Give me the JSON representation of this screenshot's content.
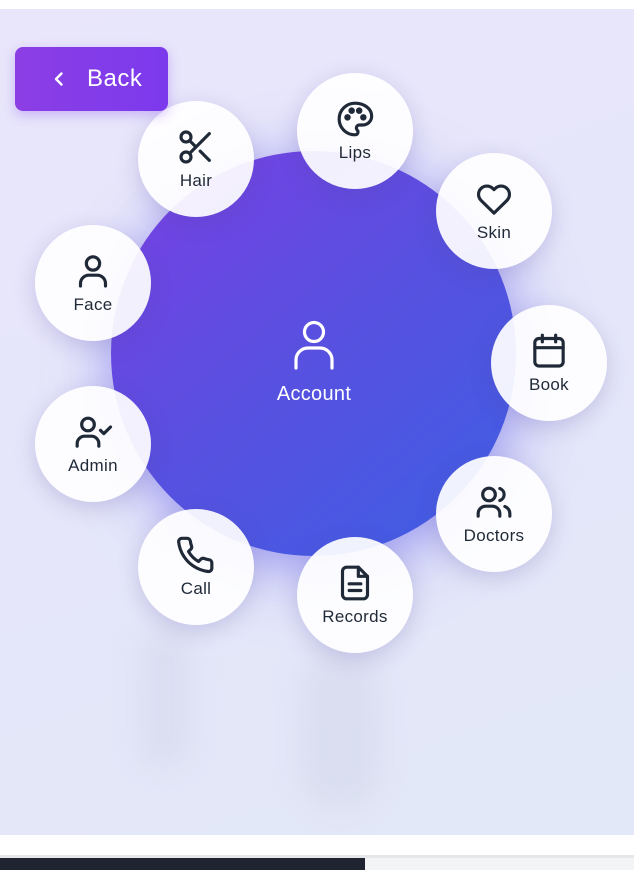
{
  "back_button": {
    "label": "Back"
  },
  "hub": {
    "label": "Account",
    "icon": "user-icon"
  },
  "menu_items": [
    {
      "label": "Lips",
      "icon": "palette-icon"
    },
    {
      "label": "Skin",
      "icon": "heart-icon"
    },
    {
      "label": "Book",
      "icon": "calendar-icon"
    },
    {
      "label": "Doctors",
      "icon": "users-icon"
    },
    {
      "label": "Records",
      "icon": "document-icon"
    },
    {
      "label": "Call",
      "icon": "phone-icon"
    },
    {
      "label": "Admin",
      "icon": "user-check-icon"
    },
    {
      "label": "Face",
      "icon": "user-icon"
    },
    {
      "label": "Hair",
      "icon": "scissors-icon"
    }
  ],
  "colors": {
    "accent": "#7c3aed",
    "hub_gradient_start": "#7b3fe4",
    "hub_gradient_end": "#3d5fe3",
    "icon": "#1f2937"
  }
}
